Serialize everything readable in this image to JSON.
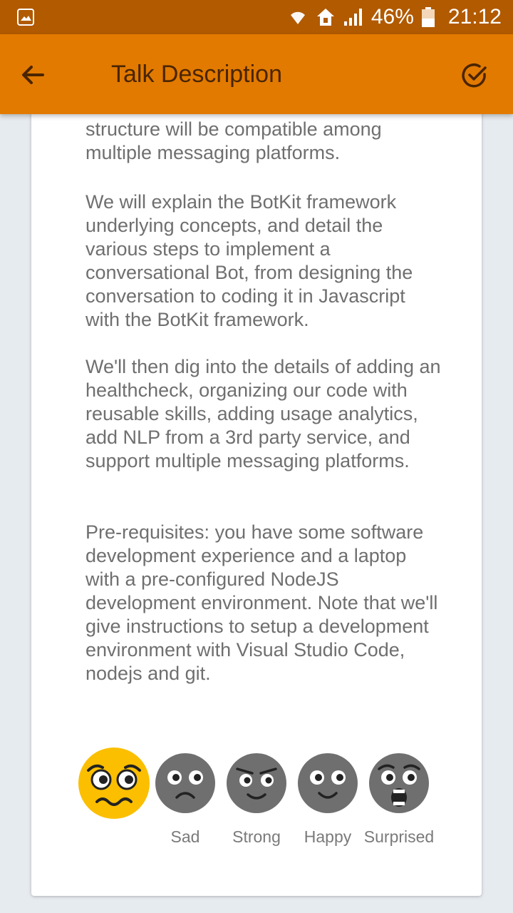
{
  "status": {
    "battery": "46%",
    "time": "21:12"
  },
  "toolbar": {
    "title": "Talk Description"
  },
  "description": {
    "p0": "create conversational bots whose structure will be compatible among multiple messaging platforms.",
    "p1": "We will explain the BotKit framework underlying concepts, and detail the various steps to implement a conversational Bot, from designing the conversation to coding it in Javascript with the BotKit framework.",
    "p2": "We'll then dig into the details of adding an healthcheck, organizing our code with reusable skills, adding usage analytics, add NLP from a 3rd party service, and support multiple messaging platforms.",
    "p3": "Pre-requisites: you have some software development experience and a laptop with a pre-configured NodeJS development environment. Note that we'll give instructions to setup a development environment with Visual Studio Code, nodejs and git."
  },
  "emotions": [
    {
      "label": "",
      "icon": "worried-face-icon",
      "selected": true,
      "color": "#fbbf00"
    },
    {
      "label": "Sad",
      "icon": "sad-face-icon",
      "selected": false,
      "color": "#6f6f6f"
    },
    {
      "label": "Strong",
      "icon": "strong-face-icon",
      "selected": false,
      "color": "#6f6f6f"
    },
    {
      "label": "Happy",
      "icon": "happy-face-icon",
      "selected": false,
      "color": "#6f6f6f"
    },
    {
      "label": "Surprised",
      "icon": "surprised-face-icon",
      "selected": false,
      "color": "#6f6f6f"
    }
  ],
  "colors": {
    "statusbar": "#b15a00",
    "appbar": "#e27a00",
    "title_text": "#4a2500",
    "body_text": "#6f6f6f",
    "background": "#e6ebef"
  }
}
